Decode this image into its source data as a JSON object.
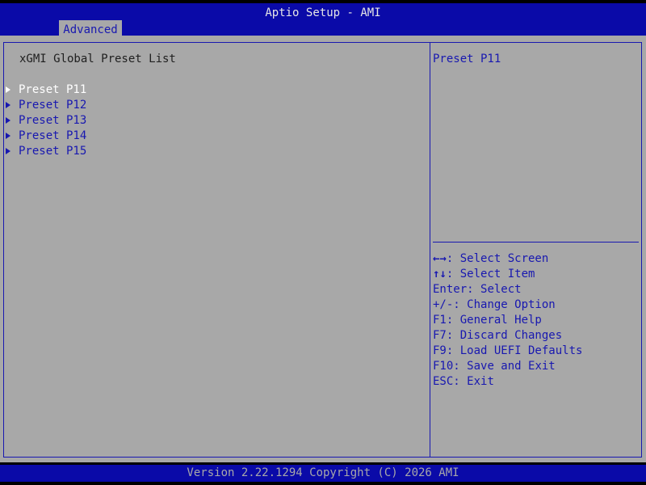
{
  "header": {
    "title": "Aptio Setup - AMI",
    "active_tab": "Advanced"
  },
  "content": {
    "heading": "xGMI Global Preset List",
    "selected_index": 0,
    "items": [
      {
        "label": "Preset P11"
      },
      {
        "label": "Preset P12"
      },
      {
        "label": "Preset P13"
      },
      {
        "label": "Preset P14"
      },
      {
        "label": "Preset P15"
      }
    ]
  },
  "help": {
    "text": "Preset P11",
    "keys": [
      {
        "key": "←→",
        "sep": ": ",
        "action": "Select Screen"
      },
      {
        "key": "↑↓",
        "sep": ": ",
        "action": "Select Item"
      },
      {
        "key": "Enter",
        "sep": ": ",
        "action": "Select"
      },
      {
        "key": "+/-",
        "sep": ": ",
        "action": "Change Option"
      },
      {
        "key": "F1",
        "sep": ": ",
        "action": "General Help"
      },
      {
        "key": "F7",
        "sep": ": ",
        "action": "Discard Changes"
      },
      {
        "key": "F9",
        "sep": ": ",
        "action": "Load UEFI Defaults"
      },
      {
        "key": "F10",
        "sep": ": ",
        "action": "Save and Exit"
      },
      {
        "key": "ESC",
        "sep": ": ",
        "action": "Exit"
      }
    ]
  },
  "footer": {
    "version": "Version 2.22.1294 Copyright (C) 2026 AMI"
  },
  "colors": {
    "bar_blue": "#0a0aa8",
    "panel_gray": "#a8a8a8",
    "text_blue": "#1818b0",
    "selected_white": "#ffffff"
  }
}
